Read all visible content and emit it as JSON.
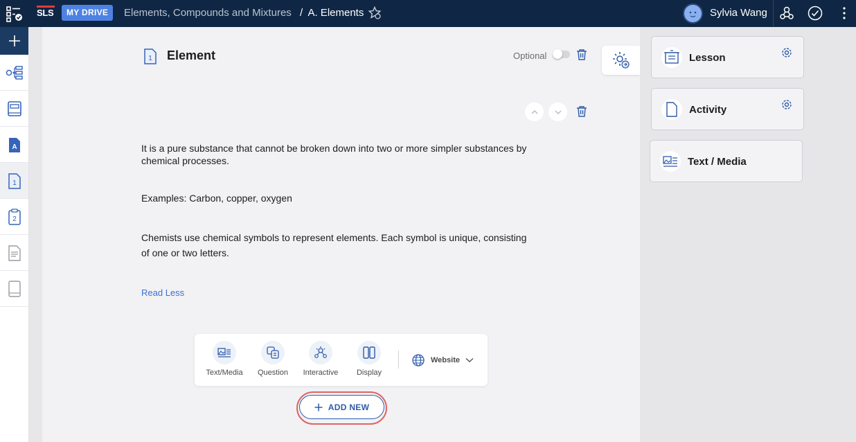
{
  "topbar": {
    "logo": "SLS",
    "drive": "MY DRIVE",
    "breadcrumb_parent": "Elements, Compounds and Mixtures",
    "breadcrumb_sep": "/",
    "breadcrumb_current": "A. Elements",
    "user_name": "Sylvia Wang",
    "icons": [
      "apps-icon",
      "star-gear-icon",
      "avatar",
      "collaboration-icon",
      "check-circle-icon",
      "more-vertical-icon"
    ]
  },
  "rail": {
    "items": [
      "add-icon",
      "tree-icon",
      "notebook-icon",
      "section-a-icon",
      "page-1-icon",
      "page-2-icon",
      "document-icon",
      "book-icon"
    ]
  },
  "main": {
    "title": "Element",
    "optional_label": "Optional",
    "paragraphs": [
      "It is a pure substance that cannot be broken down into two or more simpler substances by chemical processes.",
      "Examples: Carbon, copper, oxygen",
      "Chemists use chemical symbols to represent elements. Each symbol is unique, consisting of one or two letters."
    ],
    "read_less": "Read Less",
    "add_options": [
      {
        "label": "Text/Media"
      },
      {
        "label": "Question"
      },
      {
        "label": "Interactive"
      },
      {
        "label": "Display"
      }
    ],
    "website_label": "Website",
    "add_new": "ADD NEW"
  },
  "panel": {
    "cards": [
      {
        "label": "Lesson"
      },
      {
        "label": "Activity"
      },
      {
        "label": "Text / Media"
      }
    ]
  },
  "colors": {
    "topbar": "#0f2744",
    "accent": "#2e5aa8",
    "highlight_ring": "#e06363",
    "link": "#3b6fd4"
  }
}
